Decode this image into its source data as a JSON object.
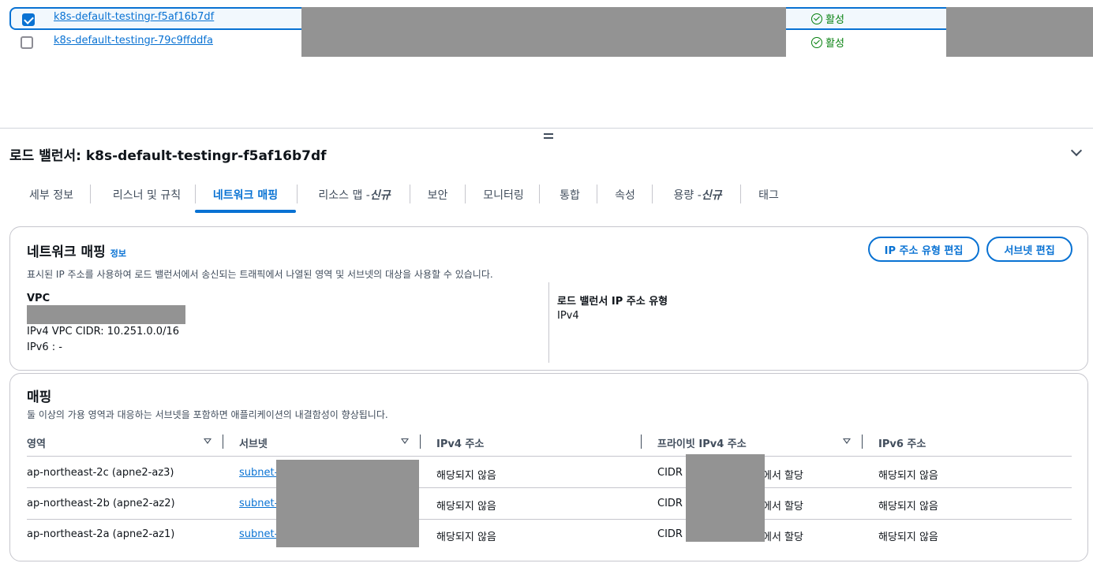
{
  "load_balancers": {
    "rows": [
      {
        "name": "k8s-default-testingr-f5af16b7df",
        "status": "활성",
        "checked": true
      },
      {
        "name": "k8s-default-testingr-79c9ffddfa",
        "status": "활성",
        "checked": false
      }
    ]
  },
  "detail": {
    "title": "로드 밸런서: k8s-default-testingr-f5af16b7df"
  },
  "tabs": [
    {
      "label": "세부 정보"
    },
    {
      "label": "리스너 및 규칙"
    },
    {
      "label": "네트워크 매핑"
    },
    {
      "label": "리소스 맵 - ",
      "badge": "신규"
    },
    {
      "label": "보안"
    },
    {
      "label": "모니터링"
    },
    {
      "label": "통합"
    },
    {
      "label": "속성"
    },
    {
      "label": "용량 - ",
      "badge": "신규"
    },
    {
      "label": "태그"
    }
  ],
  "network_mapping": {
    "title": "네트워크 매핑",
    "info": "정보",
    "description": "표시된 IP 주소를 사용하여 로드 밸런서에서 송신되는 트래픽에서 나열된 영역 및 서브넷의 대상을 사용할 수 있습니다.",
    "edit_ip_type_button": "IP 주소 유형 편집",
    "edit_subnet_button": "서브넷 편집",
    "vpc_label": "VPC",
    "vpc_cidr": "IPv4 VPC CIDR: 10.251.0.0/16",
    "vpc_ipv6": "IPv6 : -",
    "ip_type_label": "로드 밸런서 IP 주소 유형",
    "ip_type_value": "IPv4"
  },
  "mapping": {
    "title": "매핑",
    "description": "둘 이상의 가용 영역과 대응하는 서브넷을 포함하면 애플리케이션의 내결함성이 향상됩니다.",
    "columns": [
      "영역",
      "서브넷",
      "IPv4 주소",
      "프라이빗 IPv4 주소",
      "IPv6 주소"
    ],
    "rows": [
      {
        "zone": "ap-northeast-2c (apne2-az3)",
        "subnet": "subnet-",
        "ipv4": "해당되지 않음",
        "private_prefix": "CIDR",
        "private_suffix": "에서 할당",
        "ipv6": "해당되지 않음"
      },
      {
        "zone": "ap-northeast-2b (apne2-az2)",
        "subnet": "subnet-",
        "ipv4": "해당되지 않음",
        "private_prefix": "CIDR",
        "private_suffix": "에서 할당",
        "ipv6": "해당되지 않음"
      },
      {
        "zone": "ap-northeast-2a (apne2-az1)",
        "subnet": "subnet-",
        "ipv4": "해당되지 않음",
        "private_prefix": "CIDR",
        "private_suffix": "에서 할당",
        "ipv6": "해당되지 않음"
      }
    ]
  },
  "colors": {
    "link": "#0972d3",
    "success": "#037f0c",
    "border": "#c6c6cd"
  }
}
